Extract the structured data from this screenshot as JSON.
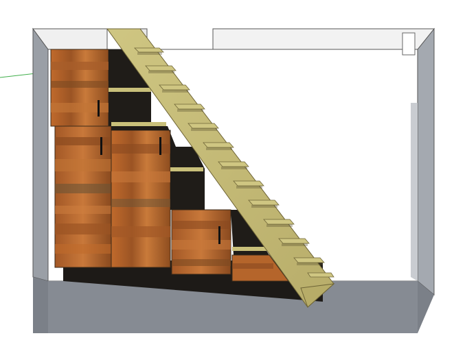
{
  "app": {
    "type": "3D modeling viewport",
    "icon_names": [
      "under-stair-storage-model",
      "green-axis-line"
    ]
  },
  "colors": {
    "background": "#ffffff",
    "wall_face": "#ffffff",
    "wall_side": "#9a9fa6",
    "wall_edge": "#6f747b",
    "floor": "#7b8088",
    "ceiling_block": "#f2f2f2",
    "wood_light": "#c9c07a",
    "wood_dark": "#8a6a3a",
    "cabinet_orange": "#b5652b",
    "cabinet_brown": "#7a4a20",
    "shadow": "#1d1a17",
    "axis_green": "#3fae4a",
    "handle": "#111111"
  },
  "model": {
    "stair_steps": 13,
    "cabinets": 4,
    "open_shelves": 4
  }
}
